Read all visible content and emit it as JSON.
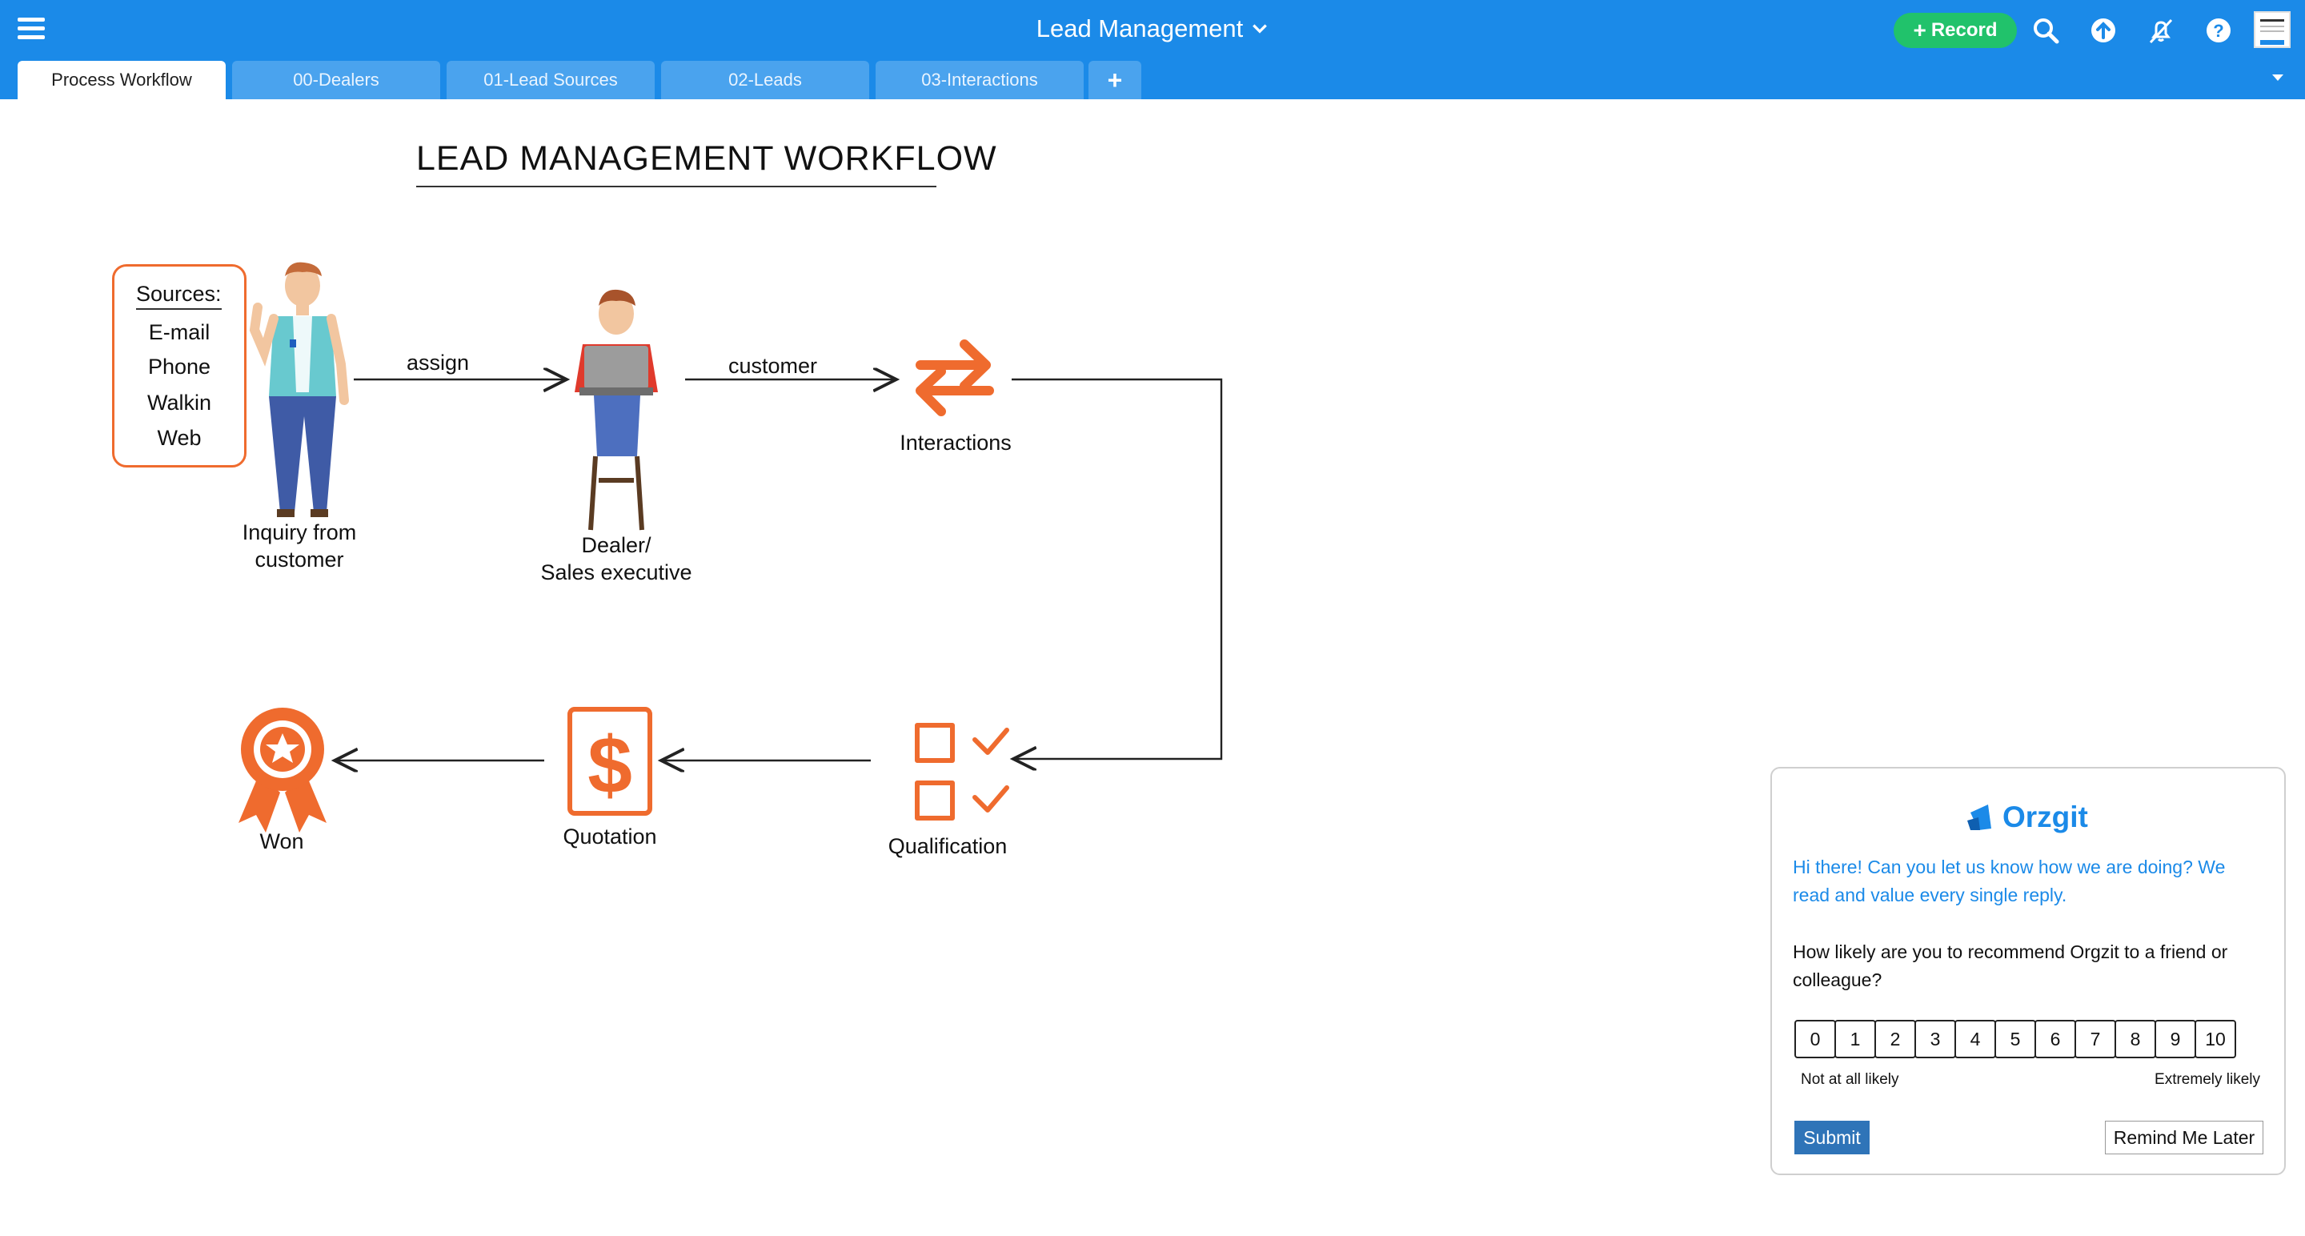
{
  "app": {
    "title": "Lead Management",
    "record_label": "Record",
    "icons": [
      "menu-icon",
      "chevron-down-icon",
      "search-icon",
      "upload-icon",
      "notifications-off-icon",
      "help-icon",
      "avatar"
    ]
  },
  "tabs": [
    {
      "label": "Process Workflow",
      "active": true
    },
    {
      "label": "00-Dealers",
      "active": false
    },
    {
      "label": "01-Lead Sources",
      "active": false
    },
    {
      "label": "02-Leads",
      "active": false
    },
    {
      "label": "03-Interactions",
      "active": false
    }
  ],
  "tab_add_label": "+",
  "workflow": {
    "title": "LEAD MANAGEMENT WORKFLOW",
    "sources": {
      "heading": "Sources:",
      "items": [
        "E-mail",
        "Phone",
        "Walkin",
        "Web"
      ]
    },
    "edges": {
      "assign": "assign",
      "customer": "customer"
    },
    "nodes": {
      "inquiry_line1": "Inquiry from",
      "inquiry_line2": "customer",
      "dealer_line1": "Dealer/",
      "dealer_line2": "Sales executive",
      "interactions": "Interactions",
      "qualification": "Qualification",
      "quotation": "Quotation",
      "won": "Won"
    },
    "accent_color": "#ef6b2e"
  },
  "survey": {
    "brand": "Orzgit",
    "intro": "Hi there! Can you let us know how we are doing? We read and value every single reply.",
    "question": "How likely are you to recommend Orgzit to a friend or colleague?",
    "scale": [
      "0",
      "1",
      "2",
      "3",
      "4",
      "5",
      "6",
      "7",
      "8",
      "9",
      "10"
    ],
    "low_label": "Not at all likely",
    "high_label": "Extremely likely",
    "submit_label": "Submit",
    "remind_label": "Remind Me Later"
  },
  "colors": {
    "topbar": "#1b8ae8",
    "record_button": "#21c26b",
    "submit_button": "#2f74b8"
  }
}
